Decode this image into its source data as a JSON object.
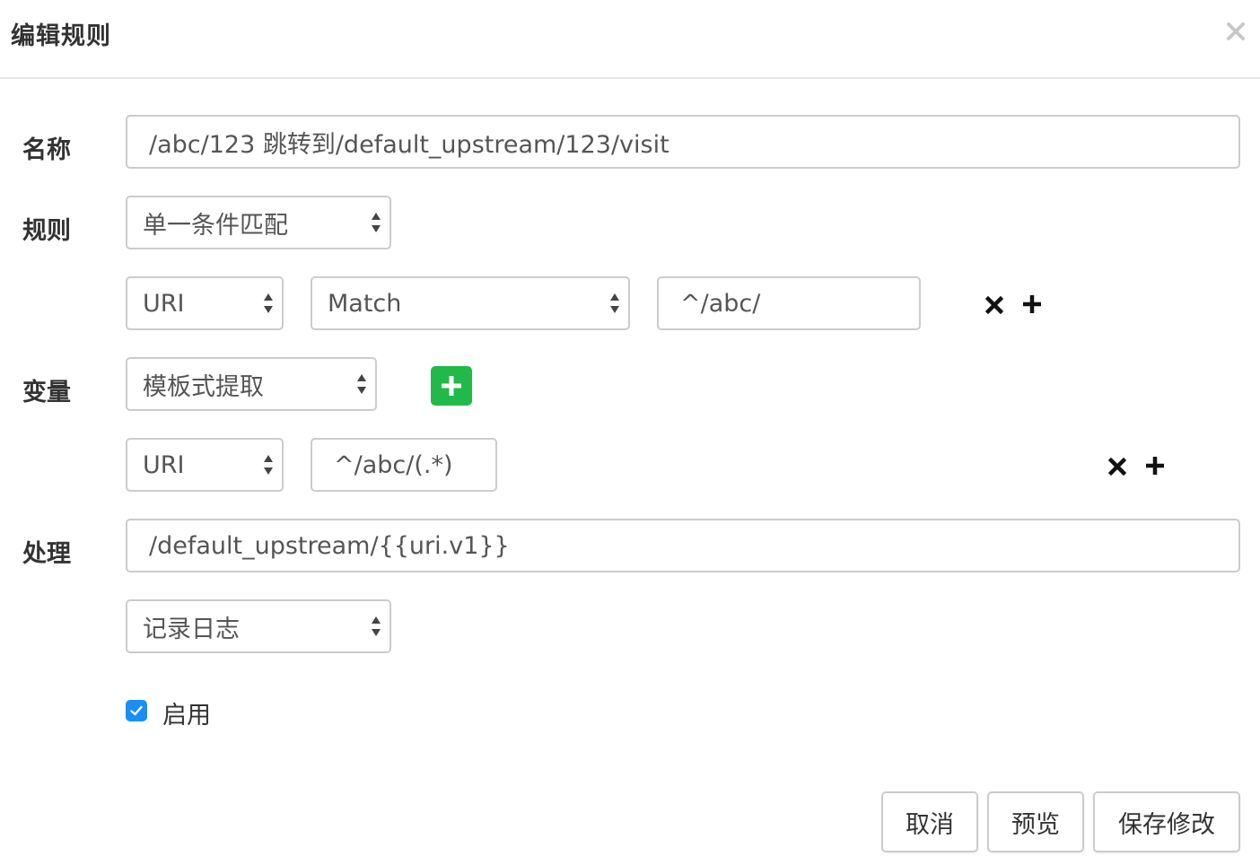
{
  "dialog": {
    "title": "编辑规则",
    "close_icon": "close-icon"
  },
  "form": {
    "name_label": "名称",
    "name_value": "/abc/123 跳转到/default_upstream/123/visit",
    "rule_label": "规则",
    "rule_type": "单一条件匹配",
    "condition": {
      "field": "URI",
      "operator": "Match",
      "value": "^/abc/"
    },
    "variable_label": "变量",
    "variable_type": "模板式提取",
    "variable_row": {
      "field": "URI",
      "pattern": "^/abc/(.*)"
    },
    "handle_label": "处理",
    "handle_value": "/default_upstream/{{uri.v1}}",
    "log_option": "记录日志",
    "enable_label": "启用",
    "enable_checked": true
  },
  "footer": {
    "cancel_label": "取消",
    "preview_label": "预览",
    "save_label": "保存修改"
  },
  "colors": {
    "accent_green": "#21b94a",
    "checkbox_blue": "#1b8ef5",
    "border": "#cccccc"
  }
}
